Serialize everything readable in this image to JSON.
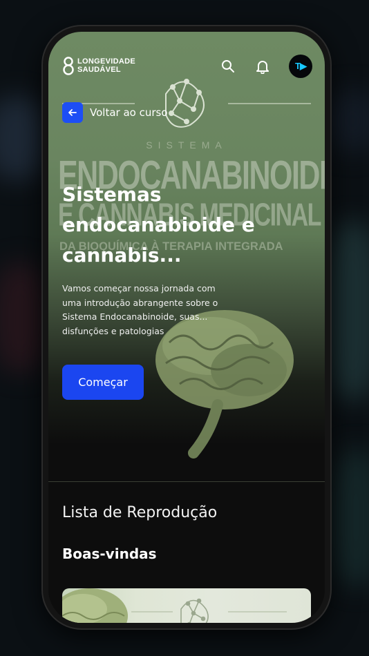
{
  "app": {
    "logo_text": "LONGEVIDADE\nSAUDÁVEL",
    "avatar_initials": "T▶"
  },
  "header": {
    "search_icon": "search-icon",
    "bell_icon": "bell-icon"
  },
  "hero": {
    "back_label": "Voltar ao curso",
    "banner_line1": "SISTEMA",
    "banner_line2": "ENDOCANABINOIDE",
    "banner_line3": "E CANNABIS MEDICINAL",
    "banner_line4": "DA BIOQUÍMICA À TERAPIA INTEGRADA",
    "title": "Sistemas endocanabioide e cannabis...",
    "description": "Vamos começar nossa jornada com uma introdução abrangente sobre o Sistema Endocanabinoide, suas... disfunções e patologias",
    "start_label": "Começar"
  },
  "playlist": {
    "title": "Lista de Reprodução",
    "section_title": "Boas-vindas"
  },
  "colors": {
    "accent": "#1b46f0",
    "hero_green": "#6e8a63",
    "background": "#0d0d0d"
  }
}
